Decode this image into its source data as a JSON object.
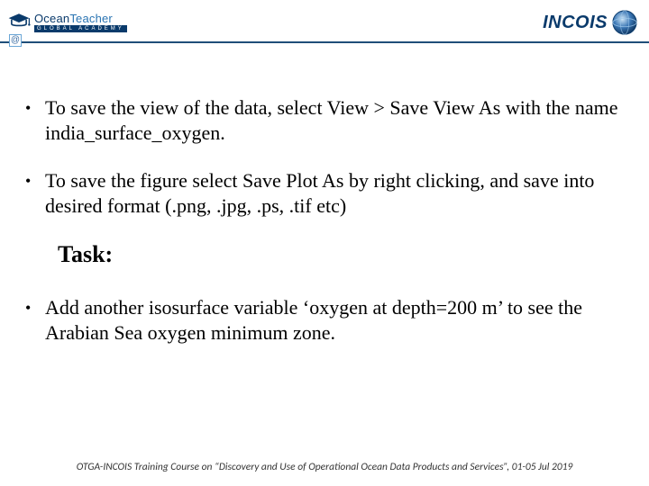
{
  "header": {
    "left_logo": {
      "at_symbol": "@",
      "line1_a": "Ocean",
      "line1_b": "Teacher",
      "line2": "GLOBAL ACADEMY"
    },
    "right_logo": {
      "text": "INCOIS"
    }
  },
  "bullets": [
    "To save the view of the data, select View > Save View As with the name india_surface_oxygen.",
    "To save the figure select Save Plot As by right clicking, and save into desired format (.png, .jpg, .ps, .tif etc)"
  ],
  "task_heading": "Task:",
  "task_bullet": "Add another isosurface variable ‘oxygen at depth=200 m’ to see the Arabian Sea oxygen minimum zone.",
  "footer": "OTGA-INCOIS Training Course on “Discovery and Use of Operational Ocean Data Products and Services”, 01-05 Jul 2019"
}
